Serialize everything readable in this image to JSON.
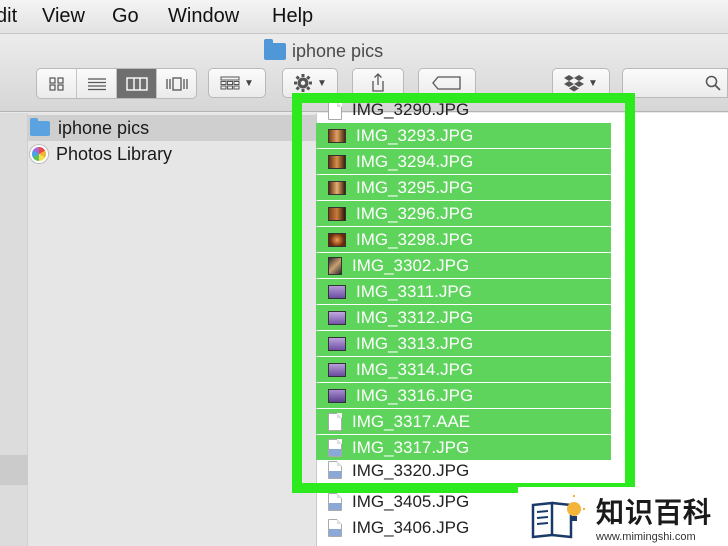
{
  "menubar": {
    "items": [
      "dit",
      "View",
      "Go",
      "Window",
      "Help"
    ]
  },
  "window": {
    "title": "iphone pics"
  },
  "toolbar": {
    "view_buttons": [
      "icon-view-icon",
      "list-view-icon",
      "column-view-icon",
      "cover-flow-icon"
    ],
    "active_view": "column-view-icon"
  },
  "sidebar": {
    "items": [
      {
        "label": "iphone pics",
        "icon": "folder-icon",
        "selected": true
      },
      {
        "label": "Photos Library",
        "icon": "photos-library-icon",
        "selected": false
      }
    ]
  },
  "files": {
    "highlighted": [
      "IMG_3293.JPG",
      "IMG_3294.JPG",
      "IMG_3295.JPG",
      "IMG_3296.JPG",
      "IMG_3298.JPG",
      "IMG_3302.JPG",
      "IMG_3311.JPG",
      "IMG_3312.JPG",
      "IMG_3313.JPG",
      "IMG_3314.JPG",
      "IMG_3316.JPG",
      "IMG_3317.AAE",
      "IMG_3317.JPG"
    ],
    "partial_top": "IMG_3290.JPG",
    "partial_bottom": "IMG_3320.JPG",
    "below": [
      "IMG_3405.JPG",
      "IMG_3406.JPG"
    ]
  },
  "watermark": {
    "brand": "知识百科",
    "url": "www.mimingshi.com"
  },
  "colors": {
    "highlight": "#5ed45c",
    "frame": "#2dea1f"
  }
}
